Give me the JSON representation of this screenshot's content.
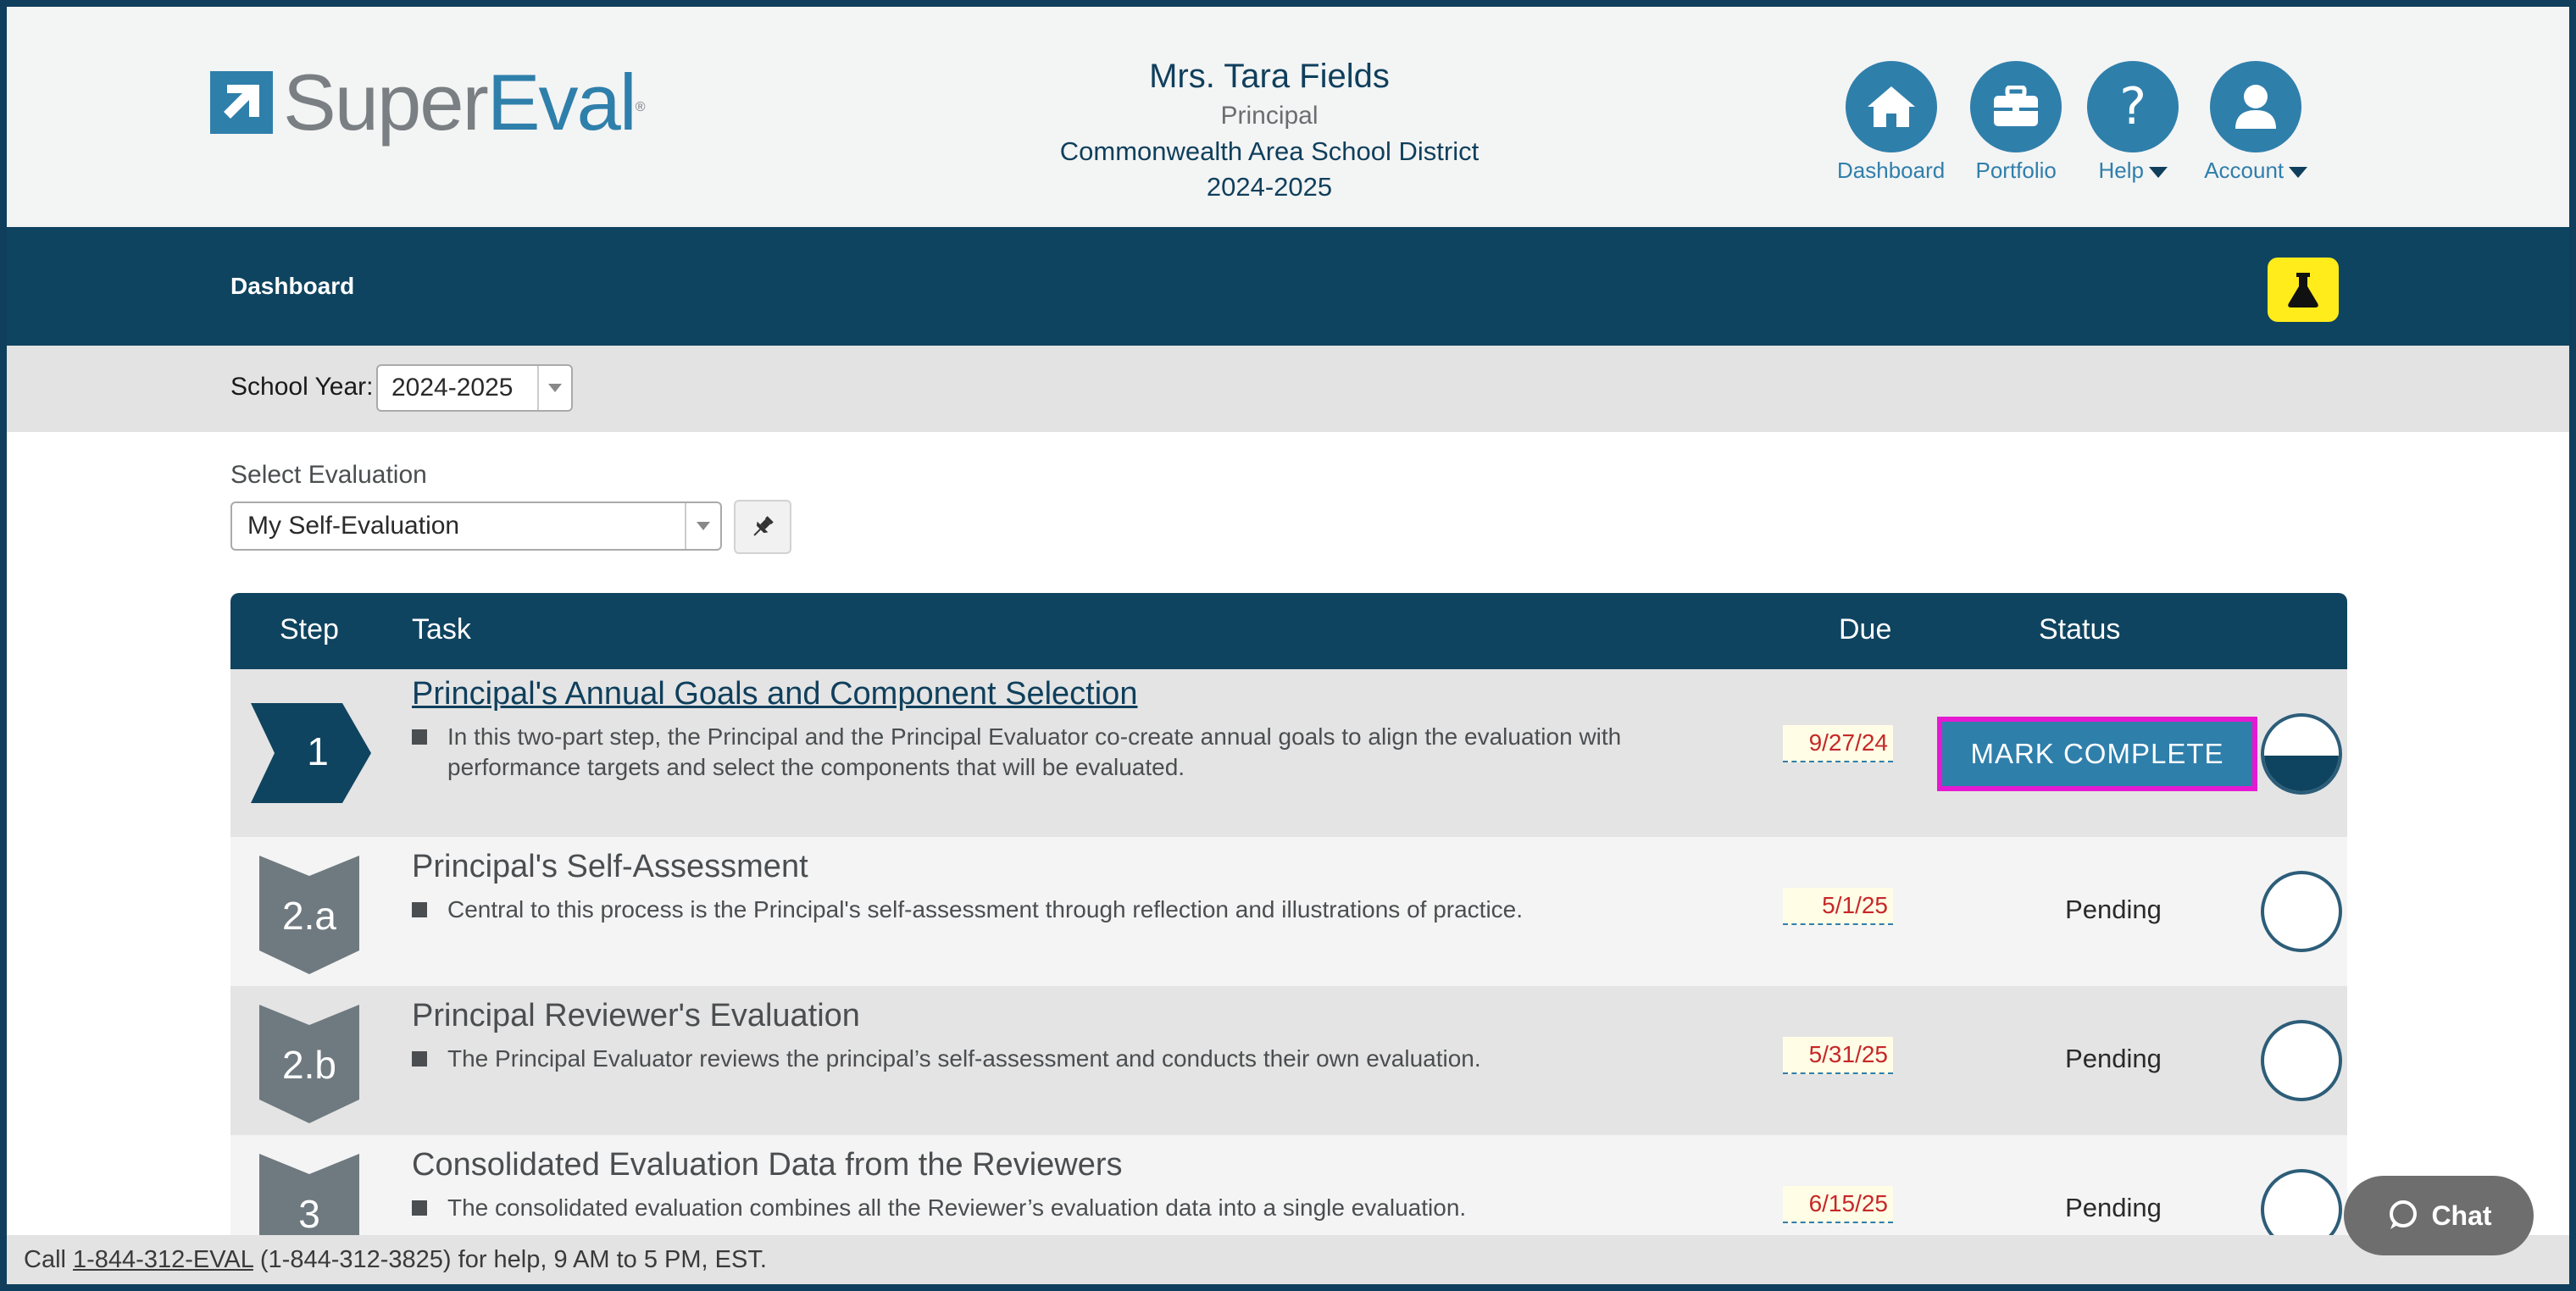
{
  "brand": {
    "logo_super": "Super",
    "logo_eval": "Eval",
    "logo_reg": "®"
  },
  "user": {
    "name": "Mrs. Tara Fields",
    "role": "Principal",
    "district": "Commonwealth Area School District",
    "year": "2024-2025"
  },
  "top_nav": [
    {
      "label": "Dashboard",
      "icon": "home-icon"
    },
    {
      "label": "Portfolio",
      "icon": "briefcase-icon"
    },
    {
      "label": "Help",
      "icon": "question-icon",
      "caret": true
    },
    {
      "label": "Account",
      "icon": "user-icon",
      "caret": true
    }
  ],
  "navbar": {
    "crumb": "Dashboard",
    "lab_icon": "flask-icon",
    "lab_color": "#ffec1a"
  },
  "school_year": {
    "label": "School Year:",
    "value": "2024-2025"
  },
  "select_evaluation": {
    "label": "Select Evaluation",
    "value": "My Self-Evaluation",
    "pin_icon": "pin-icon"
  },
  "table": {
    "headers": {
      "step": "Step",
      "task": "Task",
      "due": "Due",
      "status": "Status"
    },
    "rows": [
      {
        "step": "1",
        "title": "Principal's Annual Goals and Component Selection",
        "description": "In this two-part step, the Principal and the Principal Evaluator co-create annual goals to align the evaluation with performance targets and select the components that will be evaluated.",
        "due": "9/27/24",
        "action": "MARK COMPLETE",
        "progress": "half"
      },
      {
        "step": "2.a",
        "title": "Principal's Self-Assessment",
        "description": "Central to this process is the Principal's self-assessment through reflection and illustrations of practice.",
        "due": "5/1/25",
        "status": "Pending",
        "progress": "empty"
      },
      {
        "step": "2.b",
        "title": "Principal Reviewer's Evaluation",
        "description": "The Principal Evaluator reviews the principal’s self-assessment and conducts their own evaluation.",
        "due": "5/31/25",
        "status": "Pending",
        "progress": "empty"
      },
      {
        "step": "3",
        "title": "Consolidated Evaluation Data from the Reviewers",
        "description": "The consolidated evaluation combines all the Reviewer’s evaluation data into a single evaluation.",
        "due": "6/15/25",
        "status": "Pending",
        "progress": "empty"
      }
    ]
  },
  "footer": {
    "prefix": "Call ",
    "phone": "1-844-312-EVAL",
    "suffix": " (1-844-312-3825) for help, 9 AM to 5 PM, EST."
  },
  "chat": {
    "label": "Chat",
    "icon": "chat-bubble-icon"
  },
  "colors": {
    "primary": "#0f4460",
    "accent": "#2f7fab",
    "highlight": "#e619d2",
    "due_text": "#c62828"
  }
}
